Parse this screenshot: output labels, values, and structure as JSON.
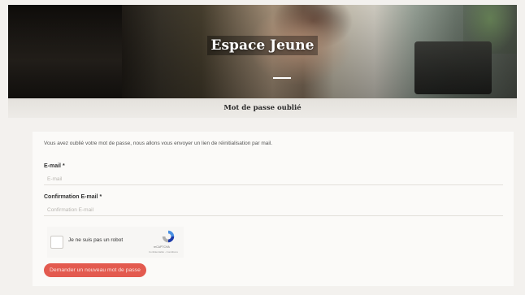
{
  "hero": {
    "title": "Espace Jeune"
  },
  "subbar": {
    "title": "Mot de passe oublié"
  },
  "form": {
    "intro": "Vous avez oublié votre mot de passe, nous allons vous envoyer un lien de réinitialisation par mail.",
    "email_label": "E-mail *",
    "email_placeholder": "E-mail",
    "confirm_label": "Confirmation E-mail *",
    "confirm_placeholder": "Confirmation E-mail",
    "captcha_text": "Je ne suis pas un robot",
    "captcha_brand": "reCAPTCHA",
    "captcha_terms": "Confidentialité - Conditions",
    "submit_label": "Demander un nouveau mot de passe"
  },
  "colors": {
    "accent": "#e35a4f",
    "background": "#f3f1ee"
  }
}
